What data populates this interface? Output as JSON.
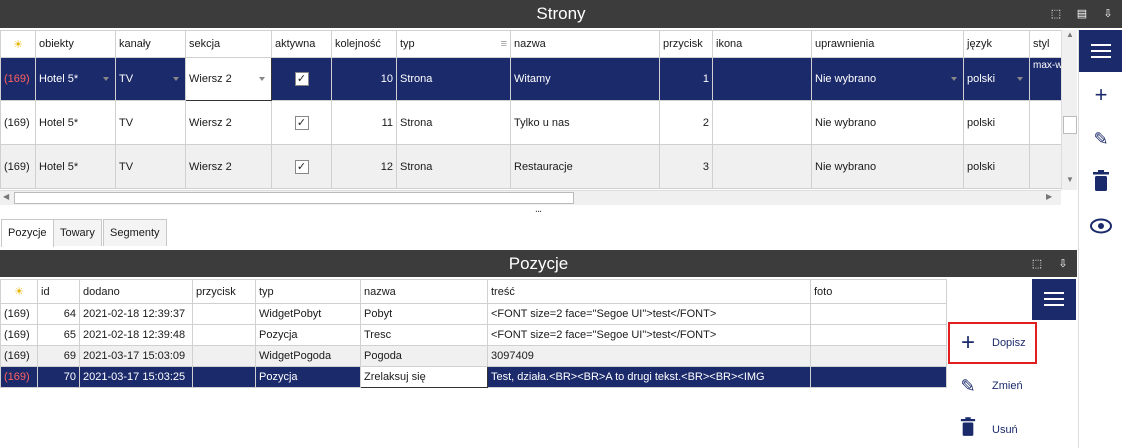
{
  "top": {
    "title": "Strony",
    "columns": [
      "☀",
      "obiekty",
      "kanały",
      "sekcja",
      "aktywna",
      "kolejność",
      "typ",
      "nazwa",
      "przycisk",
      "ikona",
      "uprawnienia",
      "język",
      "styl"
    ],
    "rows": [
      {
        "id": "(169)",
        "obiekty": "Hotel 5*",
        "kanaly": "TV",
        "sekcja": "Wiersz 2",
        "aktywna": "✓",
        "kolejnosc": "10",
        "typ": "Strona",
        "nazwa": "Witamy",
        "przycisk": "1",
        "ikona": "",
        "uprawnienia": "Nie wybrano",
        "jezyk": "polski",
        "styl": "max-w"
      },
      {
        "id": "(169)",
        "obiekty": "Hotel 5*",
        "kanaly": "TV",
        "sekcja": "Wiersz 2",
        "aktywna": "✓",
        "kolejnosc": "11",
        "typ": "Strona",
        "nazwa": "Tylko u nas",
        "przycisk": "2",
        "ikona": "",
        "uprawnienia": "Nie wybrano",
        "jezyk": "polski",
        "styl": ""
      },
      {
        "id": "(169)",
        "obiekty": "Hotel 5*",
        "kanaly": "TV",
        "sekcja": "Wiersz 2",
        "aktywna": "✓",
        "kolejnosc": "12",
        "typ": "Strona",
        "nazwa": "Restauracje",
        "przycisk": "3",
        "ikona": "",
        "uprawnienia": "Nie wybrano",
        "jezyk": "polski",
        "styl": ""
      }
    ],
    "splitter": "..."
  },
  "tabs": [
    "Pozycje",
    "Towary",
    "Segmenty"
  ],
  "bottom": {
    "title": "Pozycje",
    "columns": [
      "☀",
      "id",
      "dodano",
      "przycisk",
      "typ",
      "nazwa",
      "treść",
      "foto"
    ],
    "rows": [
      {
        "ref": "(169)",
        "id": "64",
        "dodano": "2021-02-18 12:39:37",
        "przycisk": "",
        "typ": "WidgetPobyt",
        "nazwa": "Pobyt",
        "tresc": "<FONT size=2 face=\"Segoe UI\">test</FONT>",
        "foto": ""
      },
      {
        "ref": "(169)",
        "id": "65",
        "dodano": "2021-02-18 12:39:48",
        "przycisk": "",
        "typ": "Pozycja",
        "nazwa": "Tresc",
        "tresc": "<FONT size=2 face=\"Segoe UI\">test</FONT>",
        "foto": ""
      },
      {
        "ref": "(169)",
        "id": "69",
        "dodano": "2021-03-17 15:03:09",
        "przycisk": "",
        "typ": "WidgetPogoda",
        "nazwa": "Pogoda",
        "tresc": "3097409",
        "foto": ""
      },
      {
        "ref": "(169)",
        "id": "70",
        "dodano": "2021-03-17 15:03:25",
        "przycisk": "",
        "typ": "Pozycja",
        "nazwa": "Zrelaksuj się",
        "tresc": "Test, działa.<BR><BR>A to drugi tekst.<BR><BR><IMG",
        "foto": ""
      }
    ]
  },
  "actions": {
    "add": "Dopisz",
    "edit": "Zmień",
    "delete": "Usuń"
  },
  "colors": {
    "navy": "#1b2a6b",
    "titlebar": "#3c3c3c",
    "highlight_border": "#e02020"
  }
}
